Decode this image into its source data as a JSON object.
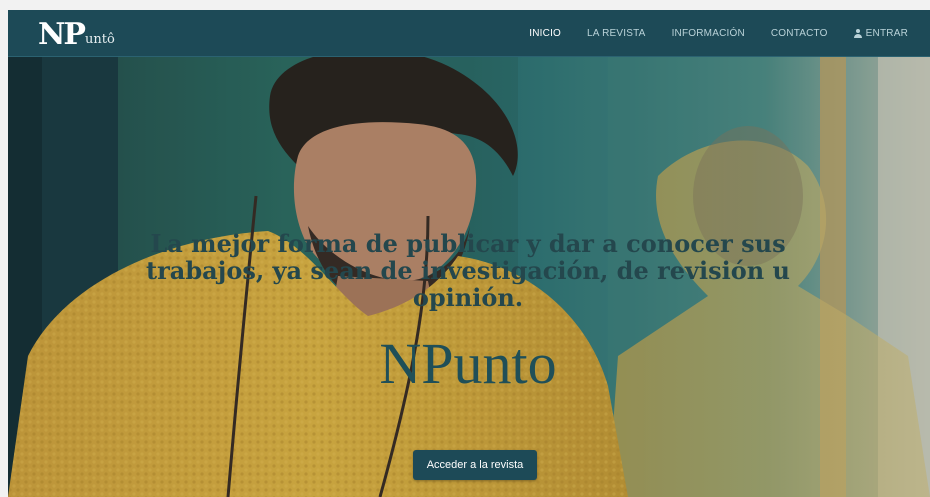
{
  "logo": {
    "initial": "NP",
    "rest": "untô"
  },
  "nav": [
    {
      "label": "INICIO",
      "active": true
    },
    {
      "label": "LA REVISTA",
      "active": false
    },
    {
      "label": "INFORMACIÓN",
      "active": false
    },
    {
      "label": "CONTACTO",
      "active": false
    },
    {
      "label": "ENTRAR",
      "icon": "user-icon",
      "active": false
    }
  ],
  "hero": {
    "headline": "La mejor forma de publicar y dar a conocer sus trabajos, ya sean de investigación, de revisión u opinión.",
    "brand": "NPunto",
    "cta_label": "Acceder a la revista"
  },
  "colors": {
    "navbar": "#1d4a57",
    "accent_text": "#24474d",
    "sweater": "#d9a634",
    "nav_text": "#b9d2d8"
  }
}
